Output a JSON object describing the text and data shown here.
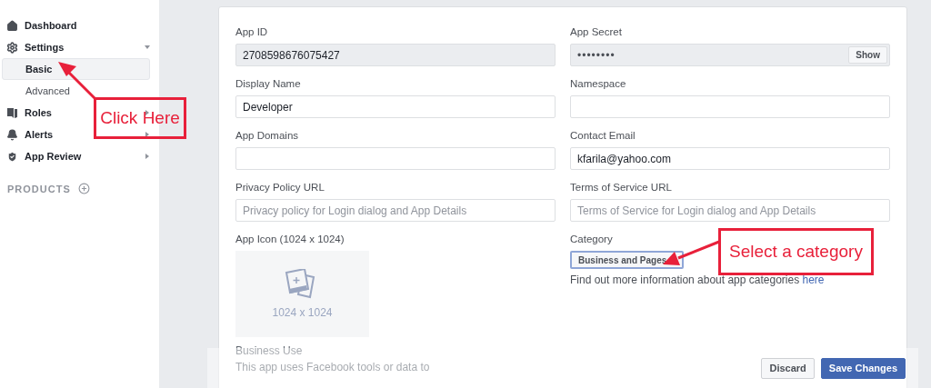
{
  "sidebar": {
    "items": [
      {
        "label": "Dashboard",
        "has_arrow": false
      },
      {
        "label": "Settings",
        "expanded": true,
        "has_arrow": true,
        "children": [
          {
            "label": "Basic",
            "selected": true
          },
          {
            "label": "Advanced",
            "selected": false
          }
        ]
      },
      {
        "label": "Roles",
        "expanded": false,
        "has_arrow": true
      },
      {
        "label": "Alerts",
        "expanded": false,
        "has_arrow": true
      },
      {
        "label": "App Review",
        "expanded": false,
        "has_arrow": true
      }
    ],
    "section": "PRODUCTS"
  },
  "form": {
    "fields": [
      {
        "kind": "readonly",
        "label": "App ID",
        "value": "2708598676075427"
      },
      {
        "kind": "secret",
        "label": "App Secret",
        "value": "••••••••",
        "button": "Show"
      },
      {
        "kind": "text",
        "label": "Display Name",
        "value": "Developer"
      },
      {
        "kind": "text",
        "label": "Namespace"
      },
      {
        "kind": "text",
        "label": "App Domains"
      },
      {
        "kind": "text",
        "label": "Contact Email",
        "value": "kfarila@yahoo.com"
      },
      {
        "kind": "text",
        "label": "Privacy Policy URL",
        "placeholder": "Privacy policy for Login dialog and App Details"
      },
      {
        "kind": "text",
        "label": "Terms of Service URL",
        "placeholder": "Terms of Service for Login dialog and App Details"
      },
      {
        "kind": "icon",
        "label": "App Icon (1024 x 1024)",
        "caption": "1024 x 1024"
      },
      {
        "kind": "select",
        "label": "Category",
        "value": "Business and Pages",
        "help": "Find out more information about app categories",
        "link": "here"
      }
    ],
    "business_use": {
      "label": "Business Use",
      "text": "This app uses Facebook tools or data to"
    }
  },
  "actions": [
    "Discard",
    "Save Changes"
  ],
  "annotations": [
    "Click Here",
    "Select a category"
  ]
}
